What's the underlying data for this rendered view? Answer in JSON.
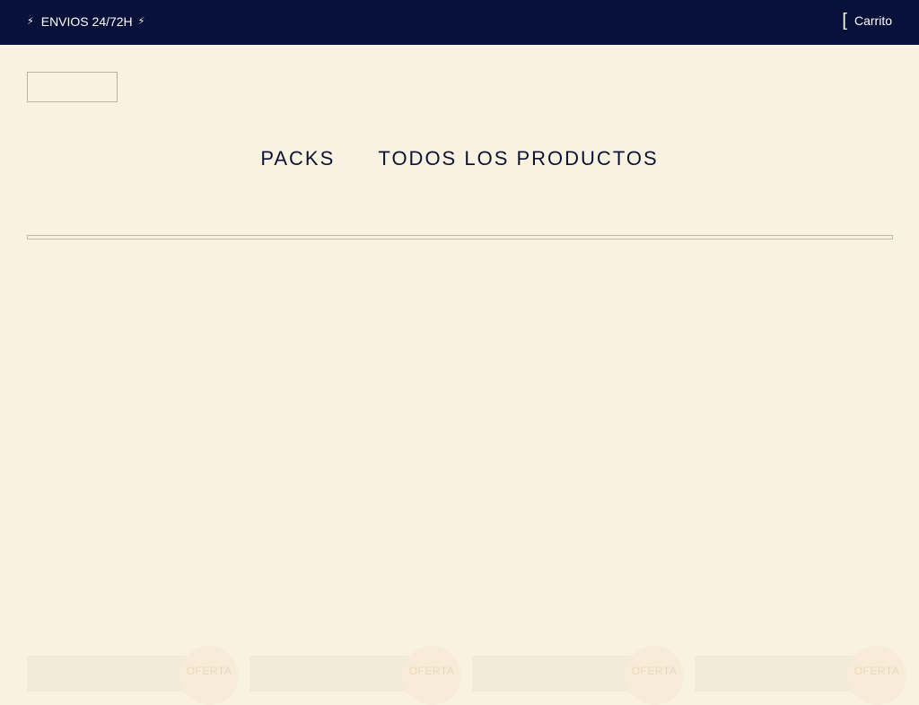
{
  "announcement": {
    "bolt": "⚡",
    "text": "ENVIOS 24/72H"
  },
  "cart": {
    "bracket": "[",
    "label": "Carrito"
  },
  "nav": {
    "items": [
      {
        "label": "PACKS"
      },
      {
        "label": "TODOS LOS PRODUCTOS"
      }
    ]
  },
  "products": [
    {
      "badge": "OFERTA"
    },
    {
      "badge": "OFERTA"
    },
    {
      "badge": "OFERTA"
    },
    {
      "badge": "OFERTA"
    }
  ],
  "colors": {
    "topbar": "#08113a",
    "background": "#f9f2e1",
    "nav_text": "#0c1233"
  }
}
